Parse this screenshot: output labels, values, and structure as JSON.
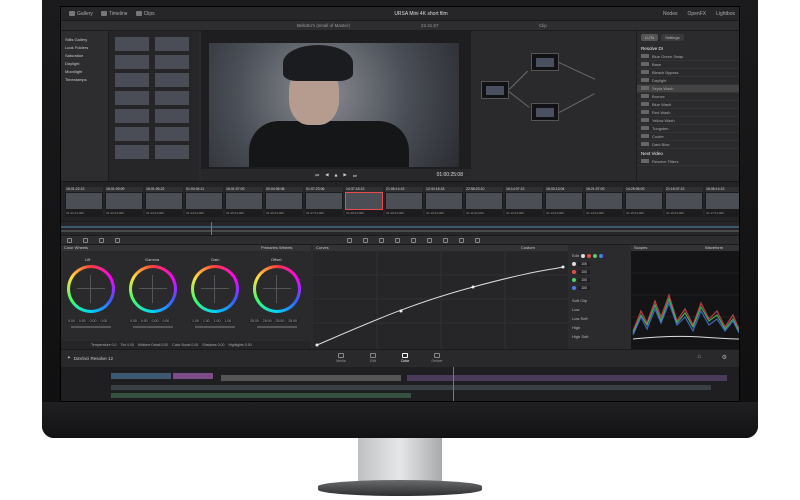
{
  "app": {
    "name": "DaVinci Resolve 12",
    "project_title": "URSA Mini 4K short film"
  },
  "topbar": {
    "items": [
      "Gallery",
      "Timeline",
      "Clips"
    ],
    "right_items": [
      "Nodes",
      "OpenFX",
      "Lightbox"
    ]
  },
  "viewer": {
    "title": "Bellotto's (small of Master)",
    "zoom": "22.41.57",
    "timecode": "01:00:25:08",
    "clip": "Clip"
  },
  "albums": {
    "items": [
      "Stills Gallery",
      "Look Folders",
      "Saturation",
      "Daylight",
      "Moonlight",
      "Timestamps"
    ]
  },
  "right_panel": {
    "tabs": [
      "LUTs",
      "Settings"
    ],
    "section1": "Resolve DI",
    "items": [
      "Blue Green Swap",
      "Base",
      "Bleach Bypass",
      "Daylight",
      "Sepia Wash",
      "Bronze",
      "Blue Wash",
      "Red Wash",
      "Yellow Wash",
      "Tungsten",
      "Cooler",
      "Dark Blue"
    ],
    "active_index": 4,
    "section2": "Next Video",
    "extra": "Resolve Filters"
  },
  "strip": {
    "clips": [
      {
        "num": "01",
        "tc": "16:01:22:13",
        "label": "V1 01:01:000"
      },
      {
        "num": "02",
        "tc": "16:01:09:09",
        "label": "V1 02:01:000"
      },
      {
        "num": "03",
        "tc": "16:01:06:22",
        "label": "V1 03:01:000"
      },
      {
        "num": "04",
        "tc": "01:00:04:11",
        "label": "V1 04:01:000"
      },
      {
        "num": "05",
        "tc": "16:01:07:03",
        "label": "V1 05:01:000"
      },
      {
        "num": "06",
        "tc": "00:04:06:08",
        "label": "V1 06:01:000"
      },
      {
        "num": "07",
        "tc": "01:07:23:06",
        "label": "V1 07:01:000"
      },
      {
        "num": "08",
        "tc": "14:37:18:13",
        "label": "V1 08:01:000"
      },
      {
        "num": "09",
        "tc": "21:06:14:15",
        "label": "V1 09:01:000"
      },
      {
        "num": "10",
        "tc": "12:44:18:18",
        "label": "V1 10:01:000"
      },
      {
        "num": "11",
        "tc": "22:58:23:10",
        "label": "V1 11:01:000"
      },
      {
        "num": "12",
        "tc": "16:14:07:13",
        "label": "V1 12:01:000"
      },
      {
        "num": "13",
        "tc": "16:00:13:04",
        "label": "V1 13:01:000"
      },
      {
        "num": "14",
        "tc": "16:21:07:03",
        "label": "V1 14:01:000"
      },
      {
        "num": "15",
        "tc": "14:25:06:03",
        "label": "V1 15:01:000"
      },
      {
        "num": "16",
        "tc": "21:15:07:13",
        "label": "V1 16:01:000"
      },
      {
        "num": "17",
        "tc": "16:06:14:13",
        "label": "V1 17:01:000"
      }
    ]
  },
  "color_wheels": {
    "header": "Color Wheels",
    "mode": "Primaries Wheels",
    "wheels": [
      {
        "name": "Lift",
        "vals": [
          "0.00",
          "0.00",
          "0.00",
          "0.00"
        ]
      },
      {
        "name": "Gamma",
        "vals": [
          "0.00",
          "0.00",
          "0.00",
          "0.00"
        ]
      },
      {
        "name": "Gain",
        "vals": [
          "1.00",
          "1.00",
          "1.00",
          "1.00"
        ]
      },
      {
        "name": "Offset",
        "vals": [
          "25.00",
          "25.00",
          "25.00",
          "25.00"
        ]
      }
    ],
    "bottom": [
      "Temperature 0.0",
      "Tint 0.00",
      "Midtone Detail 0.00",
      "Color Boost 0.00",
      "Shadows 0.00",
      "Highlights 0.00"
    ]
  },
  "curves": {
    "header": "Curves",
    "mode": "Custom"
  },
  "curve_controls": {
    "edit_label": "Edit",
    "values": [
      "100",
      "100",
      "100",
      "100"
    ],
    "soft_clip": "Soft Clip",
    "rows": [
      "Low",
      "Low Soft",
      "High",
      "High Soft"
    ]
  },
  "scopes": {
    "header": "Scopes",
    "mode": "Waveform"
  },
  "nav": {
    "tabs": [
      "Media",
      "Edit",
      "Color",
      "Deliver"
    ],
    "active": "Color"
  },
  "colors": {
    "accent": "#e84b4b",
    "playhead": "#ff4040"
  }
}
